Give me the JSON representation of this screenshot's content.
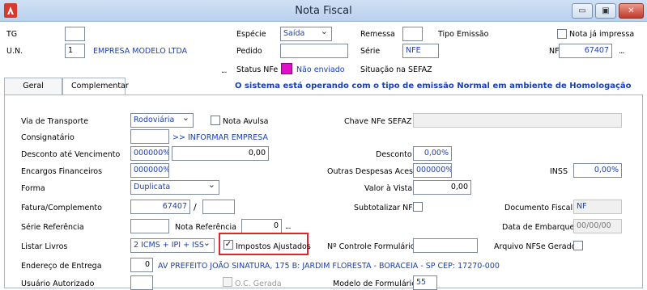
{
  "window": {
    "title": "Nota Fiscal",
    "minimize": "▭",
    "maximize": "▣",
    "close": "✕"
  },
  "header": {
    "tg_label": "TG",
    "tg_value": "",
    "un_label": "U.N.",
    "un_value": "1",
    "company_name": "EMPRESA MODELO LTDA",
    "especie_label": "Espécie",
    "especie_value": "Saída",
    "pedido_label": "Pedido",
    "pedido_value": "",
    "remessa_label": "Remessa",
    "remessa_value": "",
    "tipo_emissao_label": "Tipo Emissão",
    "serie_label": "Série",
    "serie_value": "NFE",
    "nf_label": "NF",
    "nf_value": "67407",
    "nota_ja_impressa_label": "Nota já impressa",
    "status_nfe_label": "Status NFe",
    "status_nfe_value": "Não enviado",
    "situacao_sefaz_label": "Situação na SEFAZ",
    "status_color": "#e010c8"
  },
  "tabs": [
    {
      "label": "Geral"
    },
    {
      "label": "Complementar"
    }
  ],
  "banner": "O sistema está operando com o tipo de emissão Normal em ambiente de Homologação",
  "form": {
    "via_transporte_label": "Via de Transporte",
    "via_transporte_value": "Rodoviária",
    "nota_avulsa_label": "Nota Avulsa",
    "chave_nfe_label": "Chave NFe SEFAZ",
    "chave_nfe_value": "",
    "consignatario_label": "Consignatário",
    "consignatario_value": "",
    "consignatario_hint": ">> INFORMAR EMPRESA",
    "desconto_venc_label": "Desconto até Vencimento",
    "desconto_venc_pct": "000000%",
    "desconto_venc_value": "0,00",
    "desconto_label": "Desconto",
    "desconto_value": "0,00%",
    "encargos_label": "Encargos Financeiros",
    "encargos_value": "000000%",
    "outras_despesas_label": "Outras Despesas Aces.",
    "outras_despesas_value": "000000%",
    "inss_label": "INSS",
    "inss_value": "0,00%",
    "forma_label": "Forma",
    "forma_value": "Duplicata",
    "valor_vista_label": "Valor à Vista",
    "valor_vista_value": "0,00",
    "fatura_label": "Fatura/Complemento",
    "fatura_value": "67407",
    "fatura_sep": "/",
    "fatura_complemento": "",
    "subtotalizar_label": "Subtotalizar NF",
    "documento_fiscal_label": "Documento Fiscal",
    "documento_fiscal_value": "NF",
    "serie_ref_label": "Série Referência",
    "serie_ref_value": "",
    "nota_ref_label": "Nota Referência",
    "nota_ref_value": "0",
    "data_embarque_label": "Data de Embarque",
    "data_embarque_value": "00/00/00",
    "listar_livros_label": "Listar Livros",
    "listar_livros_value": "2 ICMS + IPI + ISS",
    "impostos_ajustados_label": "Impostos Ajustados",
    "impostos_ajustados_check": "✓",
    "controle_formulario_label": "Nº Controle Formulário",
    "controle_formulario_value": "",
    "arquivo_nfse_label": "Arquivo NFSe Gerado",
    "endereco_label": "Endereço de Entrega",
    "endereco_num": "0",
    "endereco_value": "AV PREFEITO JOÃO SINATURA, 175 B: JARDIM FLORESTA - BORACEIA - SP CEP: 17270-000",
    "usuario_label": "Usuário Autorizado",
    "usuario_value": "",
    "oc_gerada_label": "O.C. Gerada",
    "modelo_formulario_label": "Modelo de Formulário",
    "modelo_formulario_value": "55",
    "ellipsis": "..."
  }
}
